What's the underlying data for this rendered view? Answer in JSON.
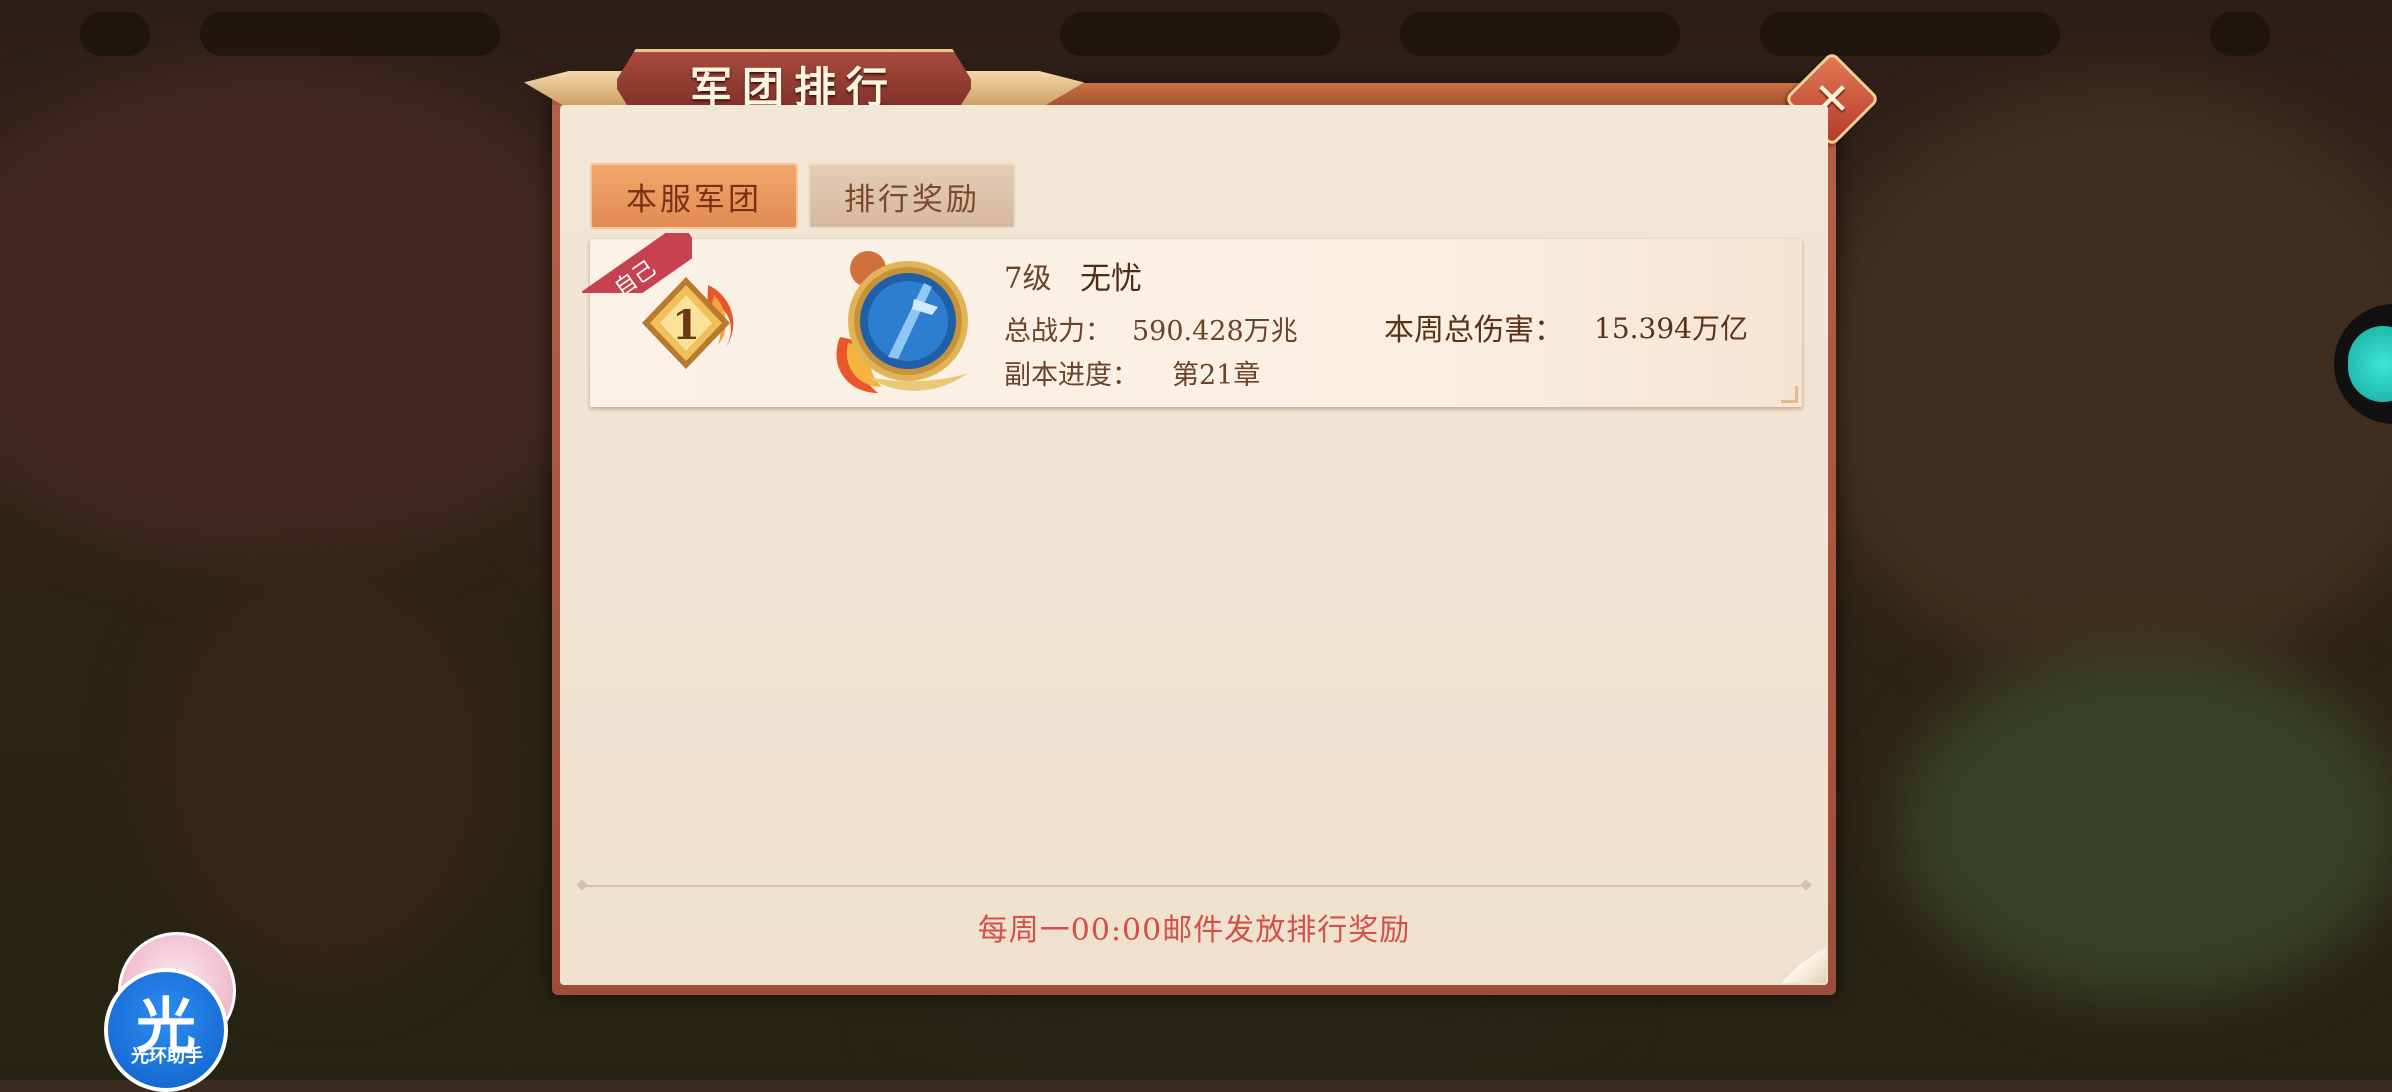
{
  "panel": {
    "title": "军团排行",
    "close_icon": "close-icon",
    "tabs": [
      {
        "label": "本服军团",
        "active": true
      },
      {
        "label": "排行奖励",
        "active": false
      }
    ]
  },
  "rank_row": {
    "self_tag": "自己",
    "rank": "1",
    "level": "7级",
    "name": "无忧",
    "power_label": "总战力：",
    "power_value": "590.428万兆",
    "progress_label": "副本进度：",
    "progress_value": "第21章",
    "damage_label": "本周总伤害：",
    "damage_value": "15.394万亿"
  },
  "footer_note": "每周一00:00邮件发放排行奖励",
  "helper": {
    "char": "光",
    "label": "光环助手"
  },
  "colors": {
    "accent_tab": "#e18c52",
    "footer_text": "#d4504a",
    "ribbon": "#c7424e"
  }
}
